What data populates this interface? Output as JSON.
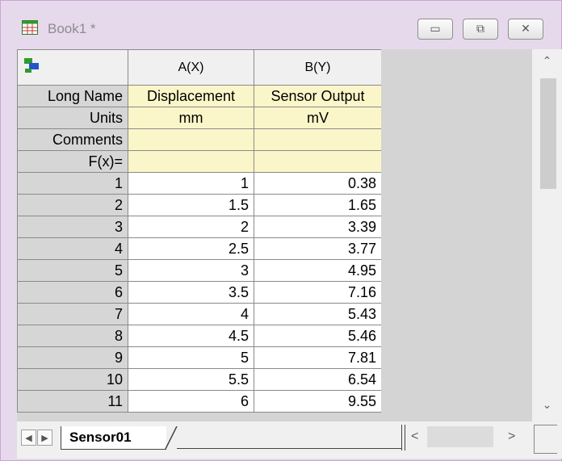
{
  "window": {
    "title": "Book1 *",
    "controls": {
      "minimize": "▭",
      "restore": "⧉",
      "close": "✕"
    },
    "accent_color": "#c9a4d2"
  },
  "grid": {
    "columns": [
      "A(X)",
      "B(Y)"
    ],
    "label_rows": [
      {
        "label": "Long Name",
        "values": [
          "Displacement",
          "Sensor Output"
        ]
      },
      {
        "label": "Units",
        "values": [
          "mm",
          "mV"
        ]
      },
      {
        "label": "Comments",
        "values": [
          "",
          ""
        ]
      },
      {
        "label": "F(x)=",
        "values": [
          "",
          ""
        ]
      }
    ],
    "rows": [
      {
        "index": "1",
        "x": "1",
        "y": "0.38"
      },
      {
        "index": "2",
        "x": "1.5",
        "y": "1.65"
      },
      {
        "index": "3",
        "x": "2",
        "y": "3.39"
      },
      {
        "index": "4",
        "x": "2.5",
        "y": "3.77"
      },
      {
        "index": "5",
        "x": "3",
        "y": "4.95"
      },
      {
        "index": "6",
        "x": "3.5",
        "y": "7.16"
      },
      {
        "index": "7",
        "x": "4",
        "y": "5.43"
      },
      {
        "index": "8",
        "x": "4.5",
        "y": "5.46"
      },
      {
        "index": "9",
        "x": "5",
        "y": "7.81"
      },
      {
        "index": "10",
        "x": "5.5",
        "y": "6.54"
      },
      {
        "index": "11",
        "x": "6",
        "y": "9.55"
      }
    ],
    "label_row_color": "#fbf6c9"
  },
  "sheets": {
    "tabs": [
      "Sensor01"
    ],
    "prev_label": "◀",
    "next_label": "▶"
  },
  "scrollbar": {
    "up": "⌃",
    "down": "⌄",
    "left": "<",
    "right": ">"
  }
}
